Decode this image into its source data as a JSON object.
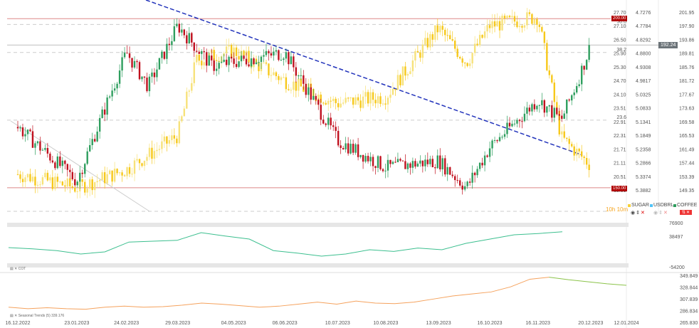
{
  "chart_data": {
    "type": "candlestick",
    "series": [
      {
        "name": "SUGAR",
        "color": "#f7d138",
        "axis": "left",
        "keypoints": [
          [
            "16.12.2022",
            20.6
          ],
          [
            "23.01.2023",
            20.0
          ],
          [
            "24.02.2023",
            20.8
          ],
          [
            "29.03.2023",
            22.3
          ],
          [
            "10.04.2023",
            25.6
          ],
          [
            "04.05.2023",
            26.0
          ],
          [
            "06.06.2023",
            24.7
          ],
          [
            "10.07.2023",
            23.7
          ],
          [
            "10.08.2023",
            24.0
          ],
          [
            "13.09.2023",
            27.0
          ],
          [
            "01.10.2023",
            25.5
          ],
          [
            "16.10.2023",
            27.1
          ],
          [
            "16.11.2023",
            27.5
          ],
          [
            "01.12.2023",
            22.2
          ],
          [
            "20.12.2023",
            21.0
          ]
        ]
      },
      {
        "name": "USDBRL",
        "color": "#4fc3f7",
        "axis": "middle",
        "keypoints": []
      },
      {
        "name": "COFFEE",
        "color_up": "#2e9e5e",
        "color_down": "#c0101e",
        "axis": "right",
        "keypoints": [
          [
            "16.12.2022",
            168
          ],
          [
            "23.01.2023",
            152
          ],
          [
            "24.02.2023",
            190
          ],
          [
            "10.03.2023",
            180
          ],
          [
            "29.03.2023",
            198
          ],
          [
            "20.04.2023",
            186
          ],
          [
            "06.06.2023",
            190
          ],
          [
            "10.07.2023",
            164
          ],
          [
            "10.08.2023",
            156
          ],
          [
            "13.09.2023",
            158
          ],
          [
            "01.10.2023",
            150
          ],
          [
            "16.10.2023",
            162
          ],
          [
            "16.11.2023",
            176
          ],
          [
            "01.12.2023",
            170
          ],
          [
            "12.12.2023",
            182
          ],
          [
            "20.12.2023",
            192.24
          ]
        ]
      }
    ],
    "axes": {
      "left_ticks": [
        "27.70",
        "27.10",
        "26.50",
        "25.90",
        "25.30",
        "24.70",
        "24.10",
        "23.51",
        "22.91",
        "22.31",
        "21.71",
        "21.11",
        "20.51",
        "19.91"
      ],
      "middle_ticks": [
        "4.7276",
        "4.7784",
        "4.8292",
        "4.8800",
        "4.9308",
        "4.9817",
        "5.0325",
        "5.0833",
        "5.1341",
        "5.1849",
        "5.2358",
        "5.2866",
        "5.3374",
        "5.3882"
      ],
      "right_ticks": [
        "201.95",
        "197.90",
        "193.86",
        "189.81",
        "185.76",
        "181.72",
        "177.67",
        "173.63",
        "169.58",
        "165.53",
        "161.49",
        "157.44",
        "153.39",
        "149.35"
      ],
      "x_ticks": [
        "16.12.2022",
        "23.01.2023",
        "24.02.2023",
        "29.03.2023",
        "04.05.2023",
        "06.06.2023",
        "10.07.2023",
        "10.08.2023",
        "13.09.2023",
        "16.10.2023",
        "16.11.2023",
        "20.12.2023",
        "12.01.2024"
      ]
    },
    "levels": {
      "upper": "200.00",
      "lower": "150.00",
      "last": "192.24",
      "fib": [
        "50.0",
        "38.2",
        "23.6"
      ]
    },
    "timer": "10h 10m",
    "cot": {
      "name": "COT",
      "ticks": [
        "76900",
        "38497",
        "-54200"
      ],
      "values": [
        -5,
        -8,
        -12,
        -20,
        -15,
        8,
        10,
        12,
        30,
        22,
        15,
        -12,
        -18,
        -25,
        -20,
        -10,
        -14,
        -6,
        -10,
        5,
        15,
        25,
        28,
        32
      ]
    },
    "seasonal": {
      "name": "Seasonal Trends (5)",
      "value": "339.176",
      "ticks": [
        "349.849",
        "328.844",
        "307.839",
        "286.834",
        "265.830"
      ],
      "values": [
        290,
        287,
        289,
        287,
        286,
        290,
        292,
        290,
        291,
        294,
        298,
        296,
        293,
        290,
        292,
        296,
        300,
        296,
        302,
        298,
        297,
        300,
        306,
        312,
        316,
        320,
        330,
        345,
        349,
        344,
        340,
        336,
        333
      ]
    }
  }
}
